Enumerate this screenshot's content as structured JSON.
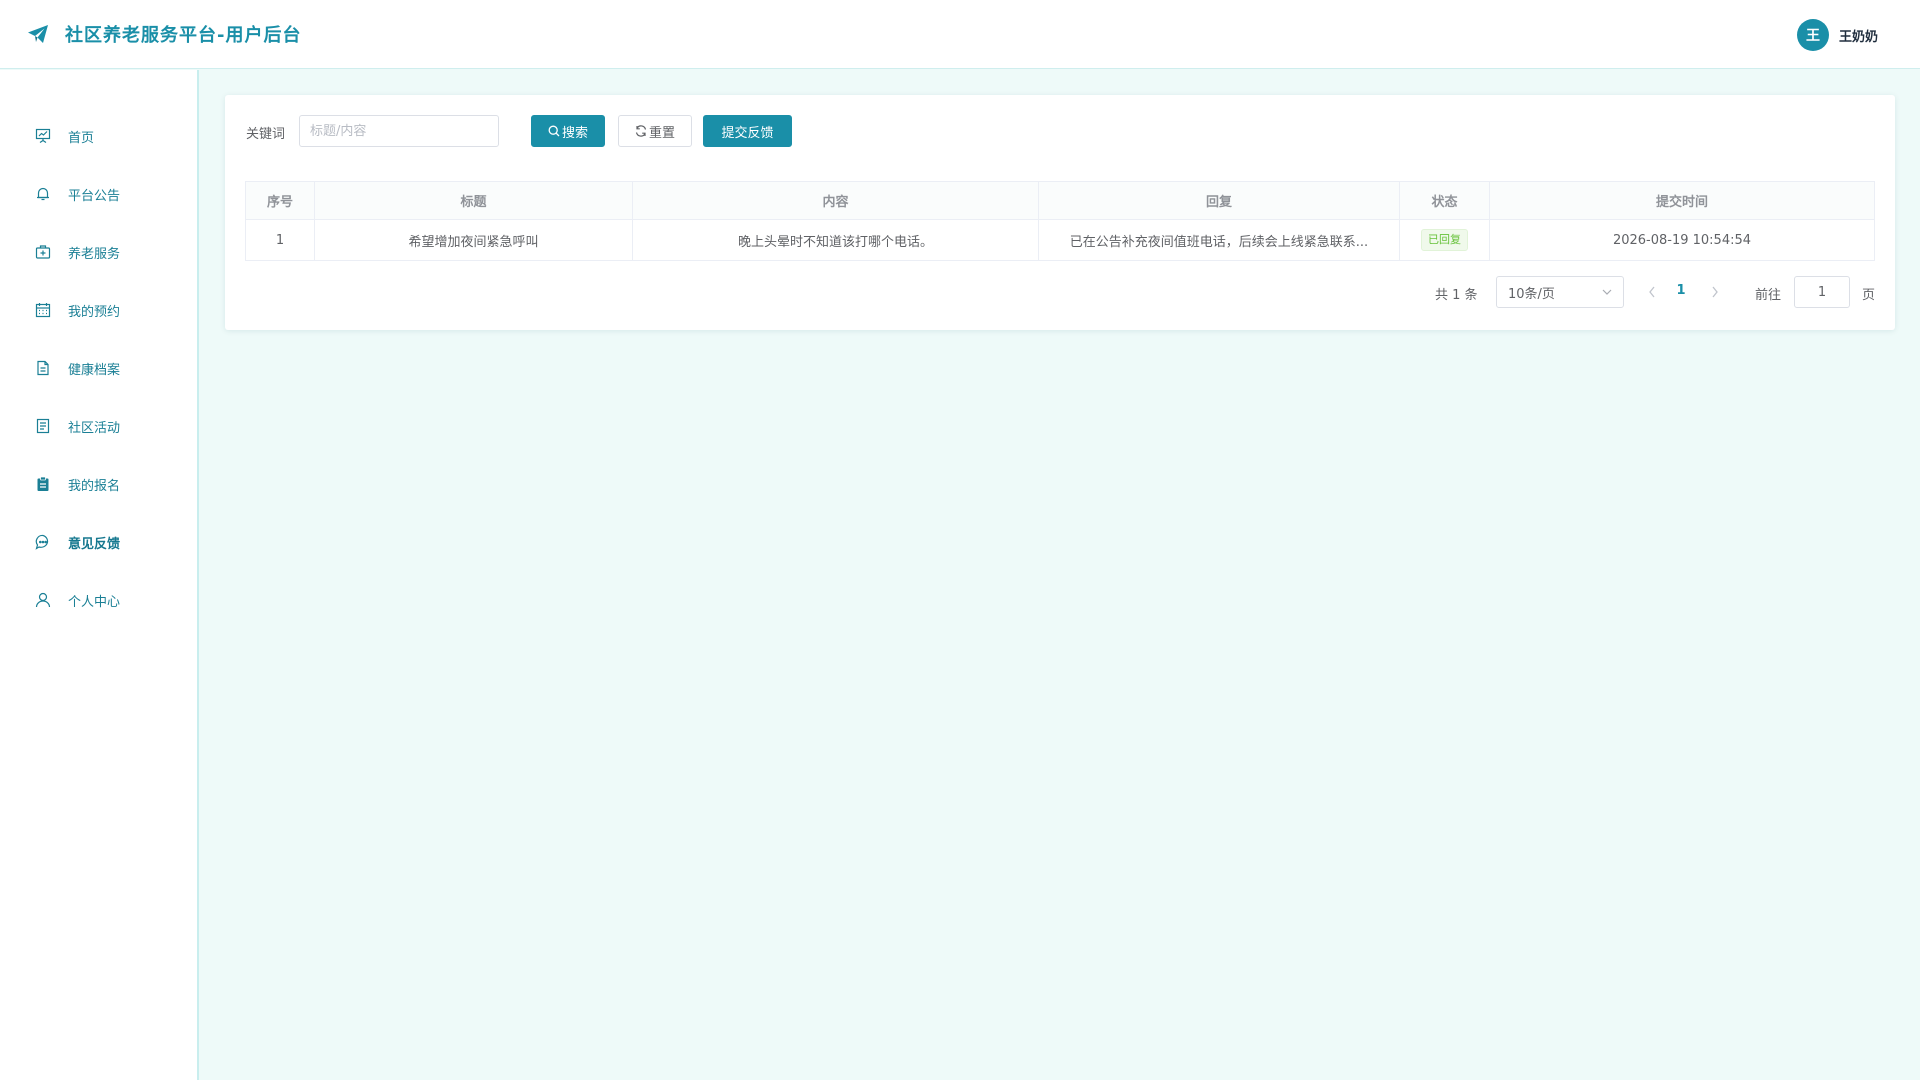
{
  "header": {
    "title": "社区养老服务平台-用户后台",
    "brand_icon": "paper-plane-icon",
    "user": {
      "avatar_text": "王",
      "name": "王奶奶"
    }
  },
  "colors": {
    "accent": "#1a8fa8",
    "background": "#eefaf9",
    "success": "#67c23a"
  },
  "sidebar": {
    "items": [
      {
        "label": "首页",
        "icon": "chart-board-icon"
      },
      {
        "label": "平台公告",
        "icon": "bell-icon"
      },
      {
        "label": "养老服务",
        "icon": "first-aid-kit-icon"
      },
      {
        "label": "我的预约",
        "icon": "calendar-icon"
      },
      {
        "label": "健康档案",
        "icon": "document-icon"
      },
      {
        "label": "社区活动",
        "icon": "list-document-icon"
      },
      {
        "label": "我的报名",
        "icon": "clipboard-icon"
      },
      {
        "label": "意见反馈",
        "icon": "chat-bubble-icon"
      },
      {
        "label": "个人中心",
        "icon": "user-icon"
      }
    ],
    "active": "意见反馈"
  },
  "filter": {
    "keyword_label": "关键词",
    "keyword_placeholder": "标题/内容",
    "keyword_value": "",
    "search_label": "搜索",
    "reset_label": "重置",
    "submit_label": "提交反馈"
  },
  "table": {
    "columns": [
      "序号",
      "标题",
      "内容",
      "回复",
      "状态",
      "提交时间"
    ],
    "rows": [
      {
        "index": "1",
        "title": "希望增加夜间紧急呼叫",
        "content": "晚上头晕时不知道该打哪个电话。",
        "reply": "已在公告补充夜间值班电话，后续会上线紧急联系...",
        "status": "已回复",
        "submitted_at": "2026-08-19 10:54:54"
      }
    ]
  },
  "pagination": {
    "total_text": "共 1 条",
    "page_size": "10条/页",
    "current_page": "1",
    "goto_label": "前往",
    "goto_value": "1",
    "page_suffix": "页"
  }
}
